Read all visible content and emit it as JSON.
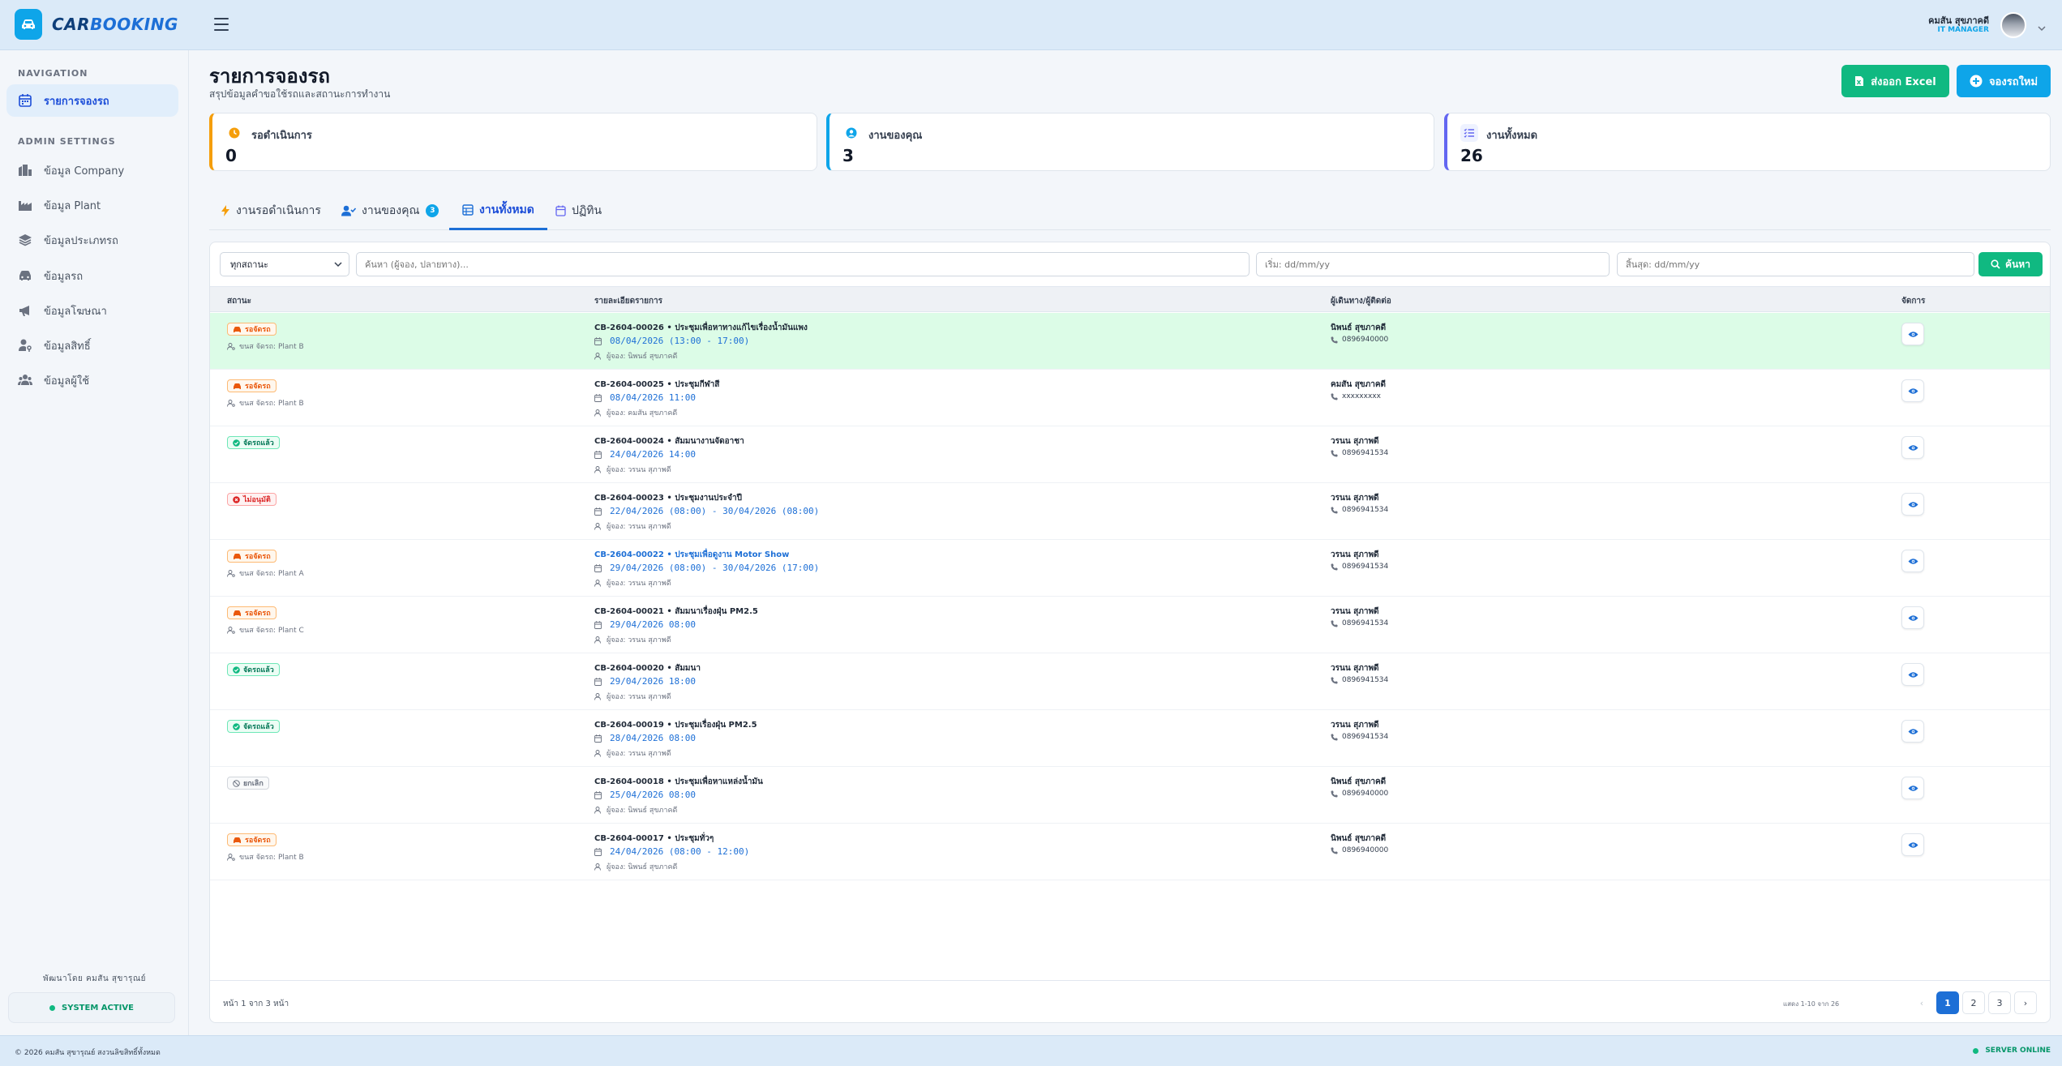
{
  "app": {
    "brand_prefix": "CAR",
    "brand_suffix": "BOOKING"
  },
  "user": {
    "name": "คมสัน สุขภาคดี",
    "role": "IT MANAGER"
  },
  "sidebar": {
    "nav_heading": "NAVIGATION",
    "admin_heading": "ADMIN SETTINGS",
    "nav_items": [
      {
        "label": "รายการจองรถ",
        "icon": "calendar-icon"
      }
    ],
    "admin_items": [
      {
        "label": "ข้อมูล Company",
        "icon": "building-icon"
      },
      {
        "label": "ข้อมูล Plant",
        "icon": "factory-icon"
      },
      {
        "label": "ข้อมูลประเภทรถ",
        "icon": "layers-icon"
      },
      {
        "label": "ข้อมูลรถ",
        "icon": "car-icon"
      },
      {
        "label": "ข้อมูลโฆษณา",
        "icon": "megaphone-icon"
      },
      {
        "label": "ข้อมูลสิทธิ์",
        "icon": "user-key-icon"
      },
      {
        "label": "ข้อมูลผู้ใช้",
        "icon": "users-icon"
      }
    ],
    "credit": "พัฒนาโดย คมสัน สุขารุณย์",
    "system_status": "SYSTEM ACTIVE"
  },
  "page": {
    "title": "รายการจองรถ",
    "subtitle": "สรุปข้อมูลคำขอใช้รถและสถานะการทำงาน",
    "export_label": "ส่งออก Excel",
    "new_label": "จองรถใหม่"
  },
  "stats": [
    {
      "label": "รอดำเนินการ",
      "value": "0",
      "color": "#f59e0b"
    },
    {
      "label": "งานของคุณ",
      "value": "3",
      "color": "#0ea5e9"
    },
    {
      "label": "งานทั้งหมด",
      "value": "26",
      "color": "#6366f1"
    }
  ],
  "tabs": [
    {
      "label": "งานรอดำเนินการ"
    },
    {
      "label": "งานของคุณ",
      "badge": "3"
    },
    {
      "label": "งานทั้งหมด",
      "active": true
    },
    {
      "label": "ปฏิทิน"
    }
  ],
  "filters": {
    "status_value": "ทุกสถานะ",
    "search_placeholder": "ค้นหา (ผู้จอง, ปลายทาง)...",
    "start_placeholder": "เริ่ม: dd/mm/yy",
    "end_placeholder": "สิ้นสุด: dd/mm/yy",
    "search_label": "ค้นหา"
  },
  "table": {
    "headers": [
      "สถานะ",
      "รายละเอียดรายการ",
      "ผู้เดินทาง/ผู้ติดต่อ",
      "จัดการ"
    ],
    "rows": [
      {
        "status": "รอจัดรถ",
        "status_type": "pending",
        "plant": "ขนส จัดรถ: Plant B",
        "title": "CB-2604-00026 • ประชุมเพื่อหาทางแก้ไขเรื่องน้ำมันแพง",
        "date": "08/04/2026 (13:00 - 17:00)",
        "user": "ผู้จอง: นิพนธ์ สุขภาคดี",
        "contact": "นิพนธ์ สุขภาคดี",
        "phone": "0896940000",
        "highlight": true
      },
      {
        "status": "รอจัดรถ",
        "status_type": "pending",
        "plant": "ขนส จัดรถ: Plant B",
        "title": "CB-2604-00025 • ประชุมกีฬาสี",
        "date": "08/04/2026 11:00",
        "user": "ผู้จอง: คมสัน สุขภาคดี",
        "contact": "คมสัน สุขภาคดี",
        "phone": "xxxxxxxxx"
      },
      {
        "status": "จัดรถแล้ว",
        "status_type": "approved",
        "plant": "",
        "title": "CB-2604-00024 • สัมมนางานจัดอาชา",
        "date": "24/04/2026 14:00",
        "user": "ผู้จอง: วรนน สุภาพดี",
        "contact": "วรนน สุภาพดี",
        "phone": "0896941534"
      },
      {
        "status": "ไม่อนุมัติ",
        "status_type": "rejected",
        "plant": "",
        "title": "CB-2604-00023 • ประชุมงานประจำปี",
        "date": "22/04/2026 (08:00) - 30/04/2026 (08:00)",
        "user": "ผู้จอง: วรนน สุภาพดี",
        "contact": "วรนน สุภาพดี",
        "phone": "0896941534"
      },
      {
        "status": "รอจัดรถ",
        "status_type": "pending",
        "plant": "ขนส จัดรถ: Plant A",
        "title": "CB-2604-00022 • ประชุมเพื่อดูงาน Motor Show",
        "date": "29/04/2026 (08:00) - 30/04/2026 (17:00)",
        "user": "ผู้จอง: วรนน สุภาพดี",
        "contact": "วรนน สุภาพดี",
        "phone": "0896941534",
        "link": true
      },
      {
        "status": "รอจัดรถ",
        "status_type": "pending",
        "plant": "ขนส จัดรถ: Plant C",
        "title": "CB-2604-00021 • สัมมนาเรื่องฝุ่น PM2.5",
        "date": "29/04/2026 08:00",
        "user": "ผู้จอง: วรนน สุภาพดี",
        "contact": "วรนน สุภาพดี",
        "phone": "0896941534"
      },
      {
        "status": "จัดรถแล้ว",
        "status_type": "approved",
        "plant": "",
        "title": "CB-2604-00020 • สัมมนา",
        "date": "29/04/2026 18:00",
        "user": "ผู้จอง: วรนน สุภาพดี",
        "contact": "วรนน สุภาพดี",
        "phone": "0896941534"
      },
      {
        "status": "จัดรถแล้ว",
        "status_type": "approved",
        "plant": "",
        "title": "CB-2604-00019 • ประชุมเรื่องฝุ่น PM2.5",
        "date": "28/04/2026 08:00",
        "user": "ผู้จอง: วรนน สุภาพดี",
        "contact": "วรนน สุภาพดี",
        "phone": "0896941534"
      },
      {
        "status": "ยกเลิก",
        "status_type": "cancel",
        "plant": "",
        "title": "CB-2604-00018 • ประชุมเพื่อหาแหล่งน้ำมัน",
        "date": "25/04/2026 08:00",
        "user": "ผู้จอง: นิพนธ์ สุขภาคดี",
        "contact": "นิพนธ์ สุขภาคดี",
        "phone": "0896940000"
      },
      {
        "status": "รอจัดรถ",
        "status_type": "pending",
        "plant": "ขนส จัดรถ: Plant B",
        "title": "CB-2604-00017 • ประชุมทั่วๆ",
        "date": "24/04/2026 (08:00 - 12:00)",
        "user": "ผู้จอง: นิพนธ์ สุขภาคดี",
        "contact": "นิพนธ์ สุขภาคดี",
        "phone": "0896940000"
      }
    ]
  },
  "pagination": {
    "summary": "หน้า 1 จาก 3 หน้า",
    "info": "แสดง 1-10 จาก 26",
    "pages": [
      "1",
      "2",
      "3"
    ],
    "current": "1"
  },
  "footer": {
    "copyright": "© 2026 คมสัน สุขารุณย์ สงวนลิขสิทธิ์ทั้งหมด",
    "server_status": "SERVER ONLINE"
  }
}
